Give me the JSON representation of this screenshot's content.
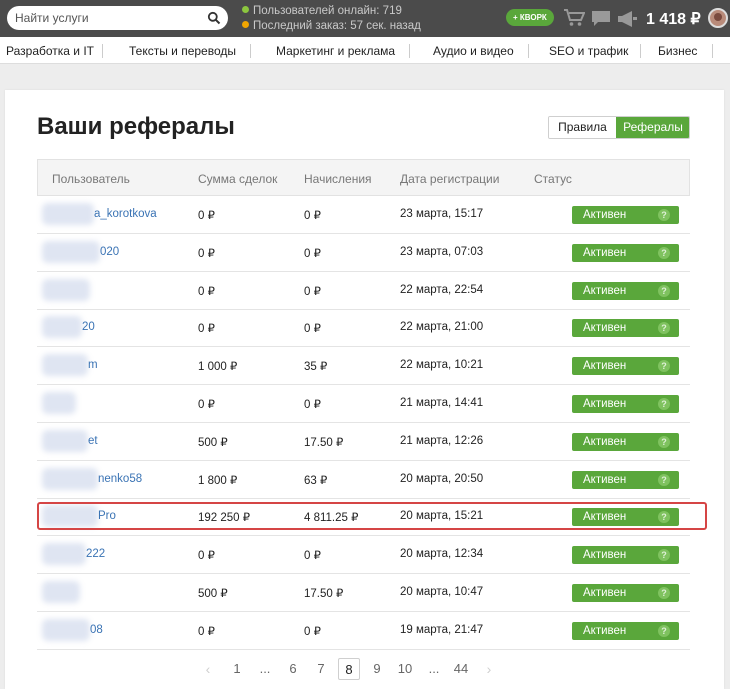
{
  "header": {
    "search_placeholder": "Найти услуги",
    "online_users": "Пользователей онлайн: 719",
    "last_order": "Последний заказ: 57 сек. назад",
    "kwork_button": "+ КВОРК",
    "balance": "1 418 ₽",
    "colors": {
      "online_dot": "#8cc63f",
      "order_dot": "#f0a500",
      "accent": "#5aa73b"
    }
  },
  "categories": [
    "Разработка и IT",
    "Тексты и переводы",
    "Маркетинг и реклама",
    "Аудио и видео",
    "SEO и трафик",
    "Бизнес"
  ],
  "page": {
    "title": "Ваши рефералы",
    "tabs": {
      "rules": "Правила",
      "referrals": "Рефералы",
      "active": "referrals"
    }
  },
  "table": {
    "headers": {
      "user": "Пользователь",
      "amount": "Сумма сделок",
      "accruals": "Начисления",
      "registered": "Дата регистрации",
      "status": "Статус"
    },
    "rows": [
      {
        "user": "a_korotkova",
        "amount": "0 ₽",
        "accrual": "0 ₽",
        "date": "23 марта, 15:17",
        "status": "Активен"
      },
      {
        "user": "020",
        "amount": "0 ₽",
        "accrual": "0 ₽",
        "date": "23 марта, 07:03",
        "status": "Активен"
      },
      {
        "user": "",
        "amount": "0 ₽",
        "accrual": "0 ₽",
        "date": "22 марта, 22:54",
        "status": "Активен"
      },
      {
        "user": "20",
        "amount": "0 ₽",
        "accrual": "0 ₽",
        "date": "22 марта, 21:00",
        "status": "Активен"
      },
      {
        "user": "m",
        "amount": "1 000 ₽",
        "accrual": "35 ₽",
        "date": "22 марта, 10:21",
        "status": "Активен"
      },
      {
        "user": "",
        "amount": "0 ₽",
        "accrual": "0 ₽",
        "date": "21 марта, 14:41",
        "status": "Активен"
      },
      {
        "user": "et",
        "amount": "500 ₽",
        "accrual": "17.50 ₽",
        "date": "21 марта, 12:26",
        "status": "Активен"
      },
      {
        "user": "nenko58",
        "amount": "1 800 ₽",
        "accrual": "63 ₽",
        "date": "20 марта, 20:50",
        "status": "Активен"
      },
      {
        "user": "Pro",
        "amount": "192 250 ₽",
        "accrual": "4 811.25 ₽",
        "date": "20 марта, 15:21",
        "status": "Активен",
        "highlighted": true
      },
      {
        "user": "222",
        "amount": "0 ₽",
        "accrual": "0 ₽",
        "date": "20 марта, 12:34",
        "status": "Активен"
      },
      {
        "user": "",
        "amount": "500 ₽",
        "accrual": "17.50 ₽",
        "date": "20 марта, 10:47",
        "status": "Активен"
      },
      {
        "user": "08",
        "amount": "0 ₽",
        "accrual": "0 ₽",
        "date": "19 марта, 21:47",
        "status": "Активен"
      }
    ],
    "status_help": "?"
  },
  "pagination": {
    "prev": "‹",
    "next": "›",
    "pages": [
      "1",
      "...",
      "6",
      "7",
      "8",
      "9",
      "10",
      "...",
      "44"
    ],
    "current": "8"
  }
}
